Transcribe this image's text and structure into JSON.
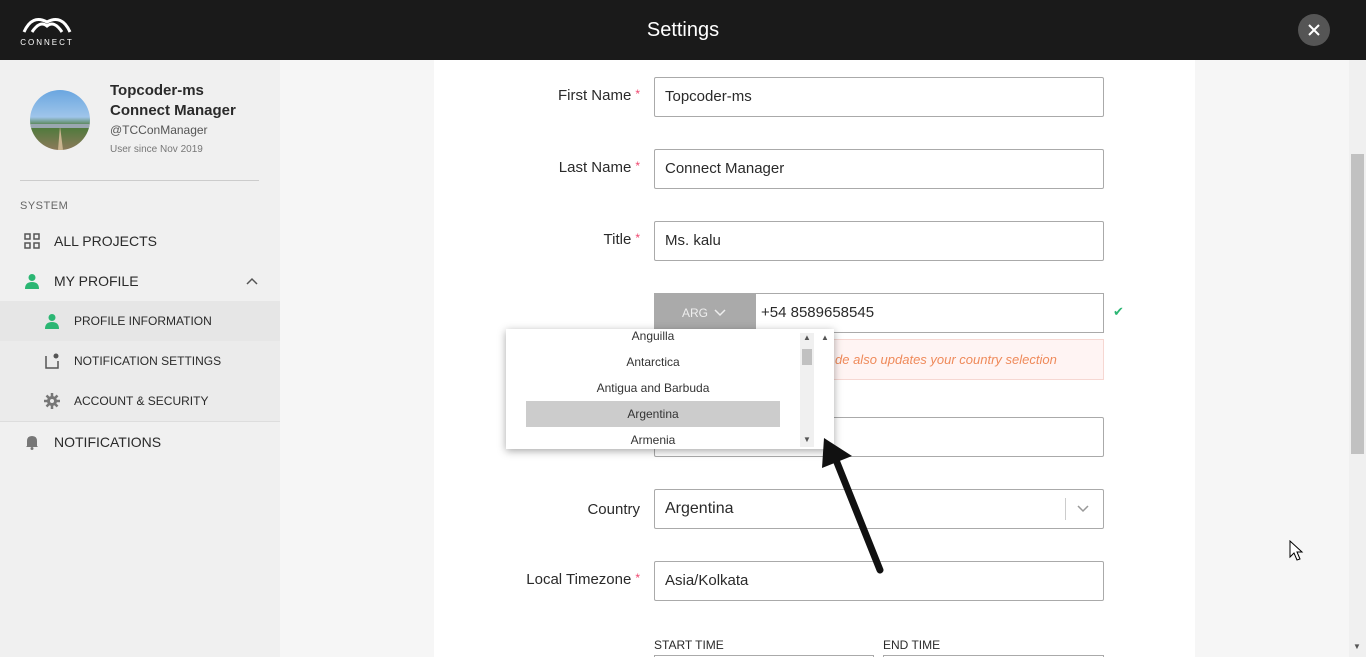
{
  "app": {
    "logo_text": "CONNECT",
    "title": "Settings"
  },
  "user": {
    "name_line1": "Topcoder-ms",
    "name_line2": "Connect Manager",
    "handle": "@TCConManager",
    "since": "User since Nov 2019"
  },
  "sidebar": {
    "section": "SYSTEM",
    "items": [
      {
        "label": "ALL PROJECTS",
        "icon": "grid-icon"
      },
      {
        "label": "MY PROFILE",
        "icon": "person-icon"
      },
      {
        "label": "NOTIFICATIONS",
        "icon": "bell-icon"
      }
    ],
    "subitems": [
      {
        "label": "PROFILE INFORMATION",
        "icon": "person-icon"
      },
      {
        "label": "NOTIFICATION SETTINGS",
        "icon": "notification-icon"
      },
      {
        "label": "ACCOUNT & SECURITY",
        "icon": "gear-icon"
      }
    ]
  },
  "form": {
    "first_name": {
      "label": "First Name",
      "value": "Topcoder-ms"
    },
    "last_name": {
      "label": "Last Name",
      "value": "Connect Manager"
    },
    "title": {
      "label": "Title",
      "value": "Ms. kalu"
    },
    "phone": {
      "code": "ARG",
      "number": "+54 8589658545"
    },
    "warning": "de also updates your country selection",
    "country": {
      "label": "Country",
      "value": "Argentina"
    },
    "timezone": {
      "label": "Local Timezone",
      "value": "Asia/Kolkata"
    },
    "start_time": "START TIME",
    "end_time": "END TIME",
    "required_mark": "*"
  },
  "dropdown": {
    "options": [
      "Anguilla",
      "Antarctica",
      "Antigua and Barbuda",
      "Argentina",
      "Armenia"
    ],
    "selected": "Argentina"
  },
  "colors": {
    "accent": "#2bb673",
    "required": "#ef476f",
    "topbar": "#1a1a1a"
  }
}
